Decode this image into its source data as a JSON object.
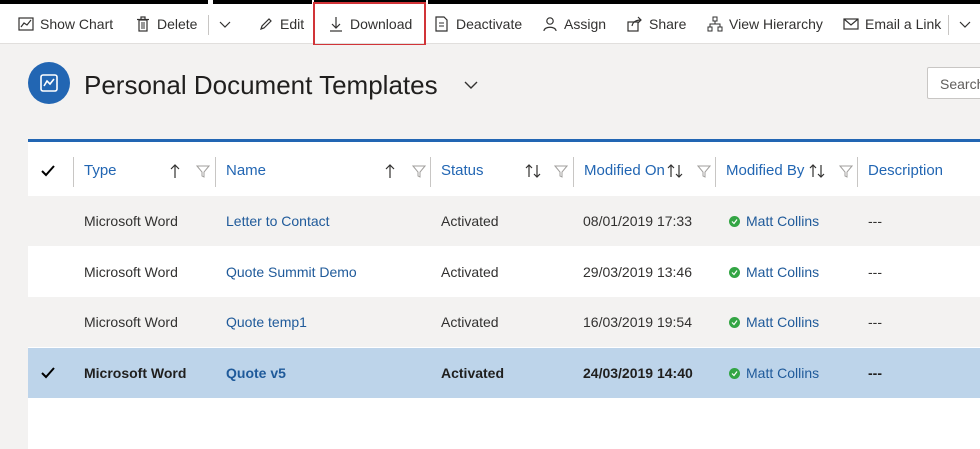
{
  "commands": {
    "show_chart": "Show Chart",
    "delete": "Delete",
    "edit": "Edit",
    "download": "Download",
    "deactivate": "Deactivate",
    "assign": "Assign",
    "share": "Share",
    "view_hierarchy": "View Hierarchy",
    "email_link": "Email a Link"
  },
  "view": {
    "title": "Personal Document Templates",
    "search_placeholder": "Search"
  },
  "columns": {
    "type": "Type",
    "name": "Name",
    "status": "Status",
    "modified_on": "Modified On",
    "modified_by": "Modified By",
    "description": "Description"
  },
  "rows": [
    {
      "type": "Microsoft Word",
      "name": "Letter to Contact",
      "status": "Activated",
      "modified_on": "08/01/2019 17:33",
      "modified_by": "Matt Collins",
      "description": "---",
      "selected": false
    },
    {
      "type": "Microsoft Word",
      "name": "Quote Summit Demo",
      "status": "Activated",
      "modified_on": "29/03/2019 13:46",
      "modified_by": "Matt Collins",
      "description": "---",
      "selected": false
    },
    {
      "type": "Microsoft Word",
      "name": "Quote temp1",
      "status": "Activated",
      "modified_on": "16/03/2019 19:54",
      "modified_by": "Matt Collins",
      "description": "---",
      "selected": false
    },
    {
      "type": "Microsoft Word",
      "name": "Quote v5",
      "status": "Activated",
      "modified_on": "24/03/2019 14:40",
      "modified_by": "Matt Collins",
      "description": "---",
      "selected": true
    }
  ],
  "colors": {
    "accent": "#2266b3",
    "link": "#1f5a9a",
    "selected_row": "#bdd4ea",
    "status_green": "#33a544",
    "highlight_box": "#d13438"
  }
}
